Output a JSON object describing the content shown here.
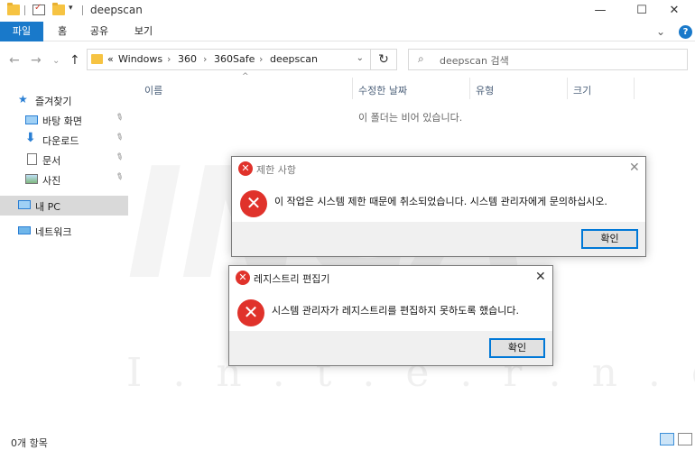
{
  "window": {
    "title": "deepscan",
    "qat_dropdown": "▾",
    "minimize": "—",
    "maximize": "☐",
    "close": "✕"
  },
  "ribbon": {
    "tabs": [
      "파일",
      "홈",
      "공유",
      "보기"
    ],
    "collapse_icon": "⌄",
    "help_icon": "?"
  },
  "nav": {
    "back": "←",
    "forward": "→",
    "recent": "⌄",
    "up": "↑"
  },
  "address": {
    "overflow": "«",
    "crumbs": [
      "Windows",
      "360",
      "360Safe",
      "deepscan"
    ],
    "separator": "›",
    "dropdown": "⌄",
    "refresh": "↻"
  },
  "search": {
    "icon": "⌕",
    "placeholder": "deepscan 검색"
  },
  "sidebar": {
    "items": [
      {
        "label": "즐겨찾기",
        "icon": "star-icon"
      },
      {
        "label": "바탕 화면",
        "icon": "desktop-icon",
        "pinned": true
      },
      {
        "label": "다운로드",
        "icon": "download-icon",
        "pinned": true
      },
      {
        "label": "문서",
        "icon": "document-icon",
        "pinned": true
      },
      {
        "label": "사진",
        "icon": "picture-icon",
        "pinned": true
      },
      {
        "label": "내 PC",
        "icon": "pc-icon",
        "selected": true
      },
      {
        "label": "네트워크",
        "icon": "network-icon"
      }
    ],
    "pin_glyph": "📌"
  },
  "columns": [
    "이름",
    "수정한 날짜",
    "유형",
    "크기"
  ],
  "sort_arrow": "^",
  "empty_message": "이 폴더는 비어 있습니다.",
  "watermark": {
    "big": "INCA",
    "small": "I.n.t.e.r.n.e.t"
  },
  "dialog1": {
    "title": "제한 사항",
    "message": "이 작업은 시스템 제한 때문에 취소되었습니다. 시스템 관리자에게 문의하십시오.",
    "button": "확인",
    "close": "✕",
    "icon_glyph": "✕"
  },
  "dialog2": {
    "title": "레지스트리 편집기",
    "message": "시스템 관리자가 레지스트리를 편집하지 못하도록 했습니다.",
    "button": "확인",
    "close": "✕",
    "icon_glyph": "✕"
  },
  "status": {
    "count": "0개 항목"
  },
  "colors": {
    "accent": "#1979ca",
    "error_red": "#e0322b",
    "dialog_footer": "#f0f0f0"
  }
}
